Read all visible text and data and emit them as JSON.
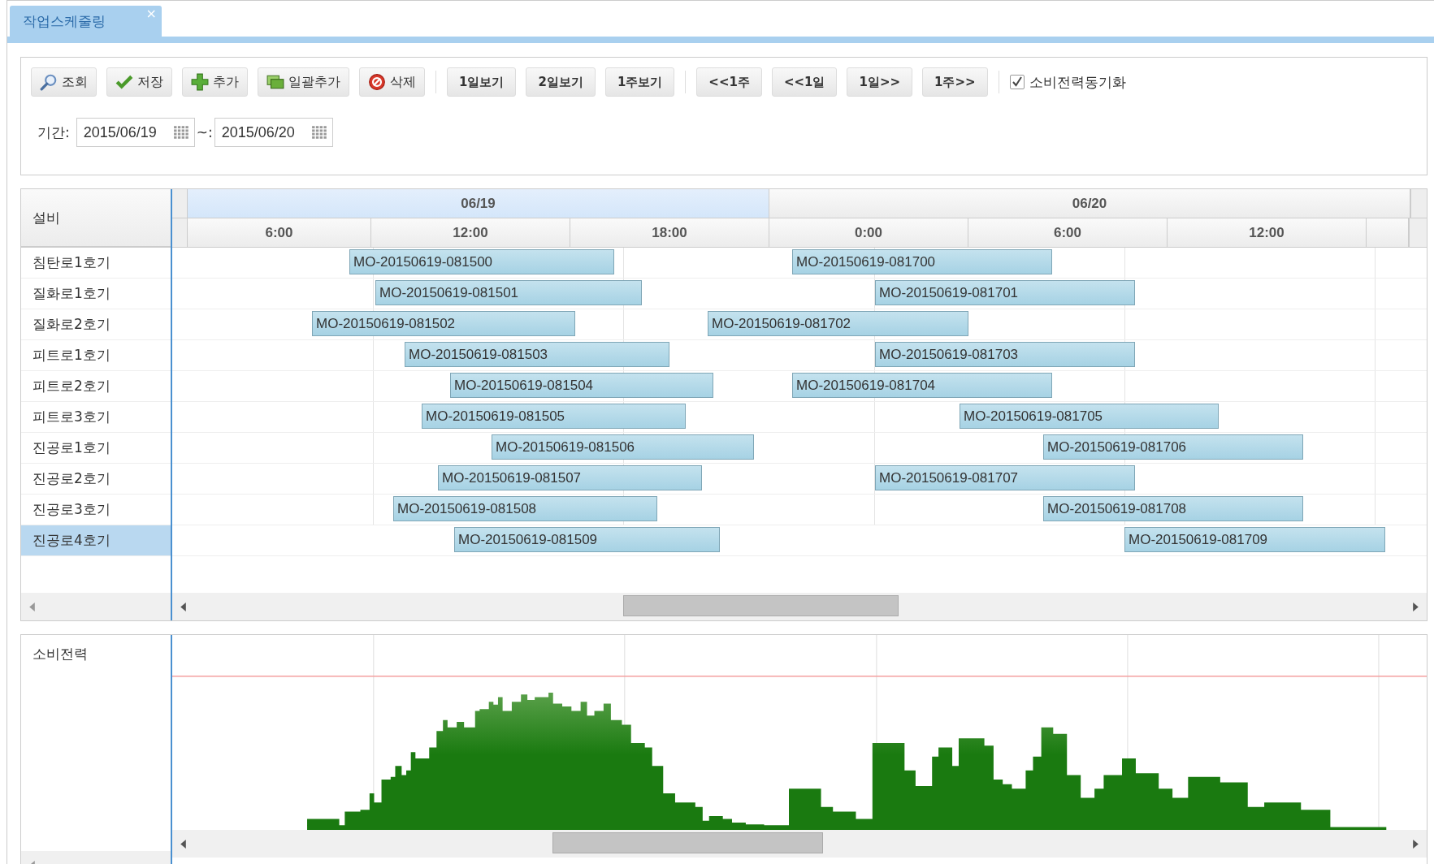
{
  "tab": {
    "title": "작업스케줄링",
    "close": "×",
    "selected": true
  },
  "toolbar": {
    "groups": [
      [
        {
          "label": "조회",
          "kind": "search"
        },
        {
          "label": "저장",
          "kind": "save"
        },
        {
          "label": "추가",
          "kind": "add"
        },
        {
          "label": "일괄추가",
          "kind": "bulk"
        },
        {
          "label": "삭제",
          "kind": "delete"
        }
      ],
      [
        {
          "label": "1일보기",
          "kind": "text"
        },
        {
          "label": "2일보기",
          "kind": "text"
        },
        {
          "label": "1주보기",
          "kind": "text"
        }
      ],
      [
        {
          "label": "<<1주",
          "kind": "text"
        },
        {
          "label": "<<1일",
          "kind": "text"
        },
        {
          "label": "1일>>",
          "kind": "text"
        },
        {
          "label": "1주>>",
          "kind": "text"
        }
      ]
    ],
    "checkbox": {
      "label": "소비전력동기화",
      "checked": true
    }
  },
  "period": {
    "label": "기간:",
    "from": "2015/06/19",
    "separator": "~:",
    "to": "2015/06/20"
  },
  "gantt": {
    "header": "설비",
    "days": [
      {
        "label": "06/19",
        "selected": true
      },
      {
        "label": "06/20",
        "selected": false
      }
    ],
    "hours": [
      "6:00",
      "12:00",
      "18:00",
      "0:00",
      "6:00",
      "12:00"
    ],
    "rows": [
      {
        "name": "침탄로1호기",
        "selected": false,
        "tasks": [
          "MO-20150619-081500",
          "MO-20150619-081700"
        ]
      },
      {
        "name": "질화로1호기",
        "selected": false,
        "tasks": [
          "MO-20150619-081501",
          "MO-20150619-081701"
        ]
      },
      {
        "name": "질화로2호기",
        "selected": false,
        "tasks": [
          "MO-20150619-081502",
          "MO-20150619-081702"
        ]
      },
      {
        "name": "피트로1호기",
        "selected": false,
        "tasks": [
          "MO-20150619-081503",
          "MO-20150619-081703"
        ]
      },
      {
        "name": "피트로2호기",
        "selected": false,
        "tasks": [
          "MO-20150619-081504",
          "MO-20150619-081704"
        ]
      },
      {
        "name": "피트로3호기",
        "selected": false,
        "tasks": [
          "MO-20150619-081505",
          "MO-20150619-081705"
        ]
      },
      {
        "name": "진공로1호기",
        "selected": false,
        "tasks": [
          "MO-20150619-081506",
          "MO-20150619-081706"
        ]
      },
      {
        "name": "진공로2호기",
        "selected": false,
        "tasks": [
          "MO-20150619-081507",
          "MO-20150619-081707"
        ]
      },
      {
        "name": "진공로3호기",
        "selected": false,
        "tasks": [
          "MO-20150619-081508",
          "MO-20150619-081708"
        ]
      },
      {
        "name": "진공로4호기",
        "selected": true,
        "tasks": [
          "MO-20150619-081509",
          "MO-20150619-081709"
        ]
      }
    ]
  },
  "power": {
    "label": "소비전력"
  }
}
